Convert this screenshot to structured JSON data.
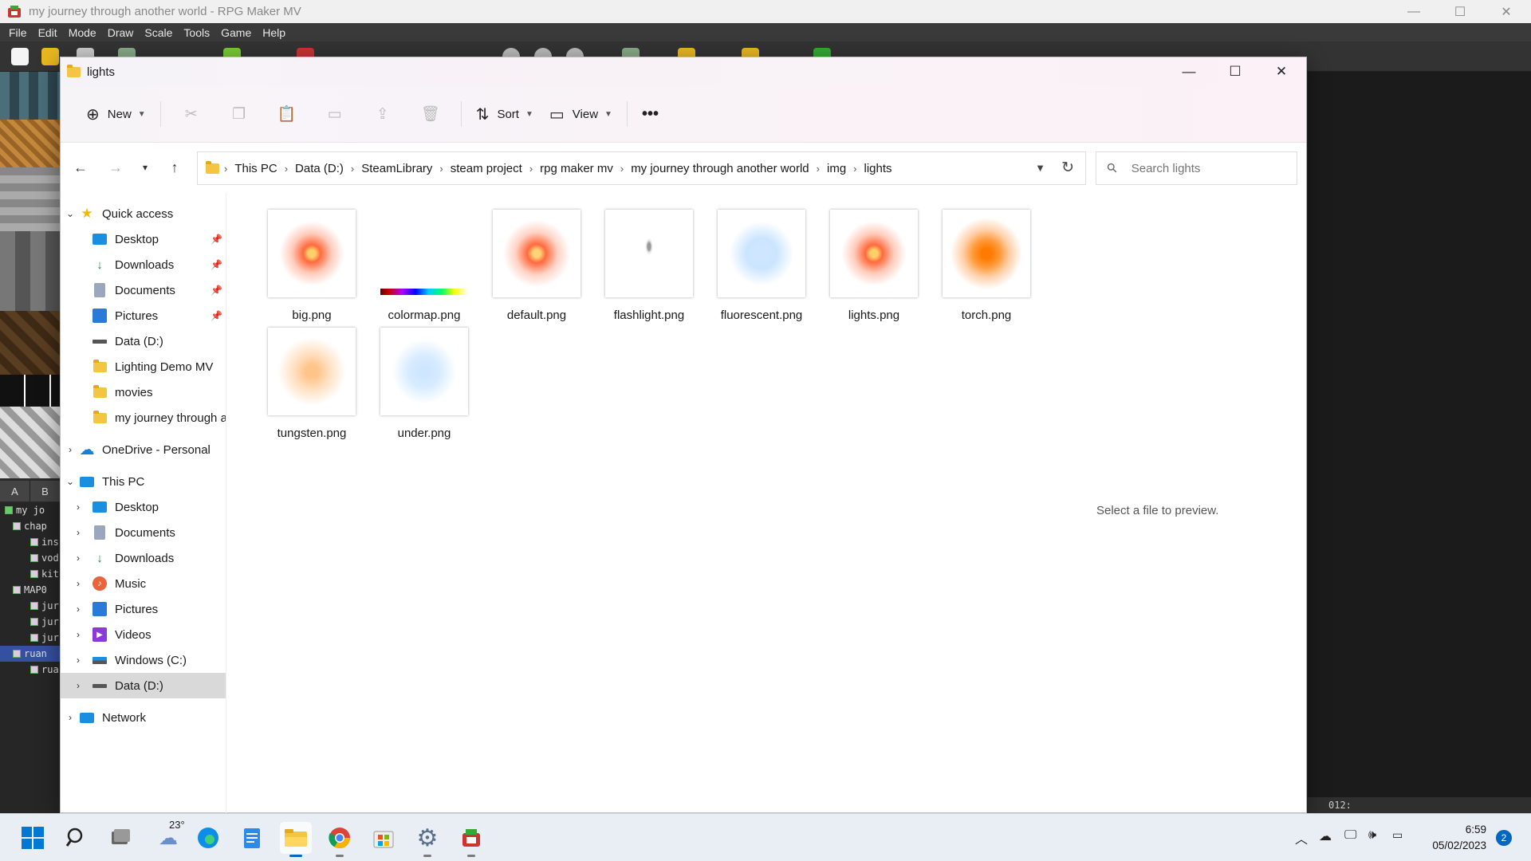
{
  "rpg": {
    "window_title": "my journey through another world - RPG Maker MV",
    "menu": [
      "File",
      "Edit",
      "Mode",
      "Draw",
      "Scale",
      "Tools",
      "Game",
      "Help"
    ],
    "tile_tabs": [
      "A",
      "B"
    ],
    "map_tree": [
      "my jo",
      "chap",
      "ins",
      "vod",
      "kit",
      "MAP0",
      "jur",
      "jur",
      "jur",
      "ruan",
      "rua"
    ],
    "status_text": "012:"
  },
  "explorer": {
    "title": "lights",
    "toolbar": {
      "new_label": "New",
      "sort_label": "Sort",
      "view_label": "View"
    },
    "breadcrumb": [
      "This PC",
      "Data (D:)",
      "SteamLibrary",
      "steam project",
      "rpg maker mv",
      "my journey through another world",
      "img",
      "lights"
    ],
    "search_placeholder": "Search lights",
    "nav": {
      "quick_access": "Quick access",
      "quick_items": [
        "Desktop",
        "Downloads",
        "Documents",
        "Pictures",
        "Data (D:)",
        "Lighting Demo MV",
        "movies",
        "my journey through a"
      ],
      "onedrive": "OneDrive - Personal",
      "this_pc": "This PC",
      "pc_items": [
        "Desktop",
        "Documents",
        "Downloads",
        "Music",
        "Pictures",
        "Videos",
        "Windows (C:)",
        "Data (D:)"
      ],
      "network": "Network"
    },
    "files": [
      {
        "name": "big.png",
        "color": "#ff6a3d"
      },
      {
        "name": "colormap.png",
        "color": "#a060ff"
      },
      {
        "name": "default.png",
        "color": "#ff6a3d"
      },
      {
        "name": "flashlight.png",
        "color": "#bbbbbb"
      },
      {
        "name": "fluorescent.png",
        "color": "#a9d4ff"
      },
      {
        "name": "lights.png",
        "color": "#ff6a3d"
      },
      {
        "name": "torch.png",
        "color": "#ff8c1a"
      },
      {
        "name": "tungsten.png",
        "color": "#ffc48a"
      },
      {
        "name": "under.png",
        "color": "#b8dcff"
      }
    ],
    "preview_text": "Select a file to preview."
  },
  "taskbar": {
    "weather_temp": "23°",
    "time": "6:59",
    "date": "05/02/2023",
    "notifications": "2"
  },
  "colors": {
    "accent": "#0067c0",
    "folder": "#f4c542"
  }
}
